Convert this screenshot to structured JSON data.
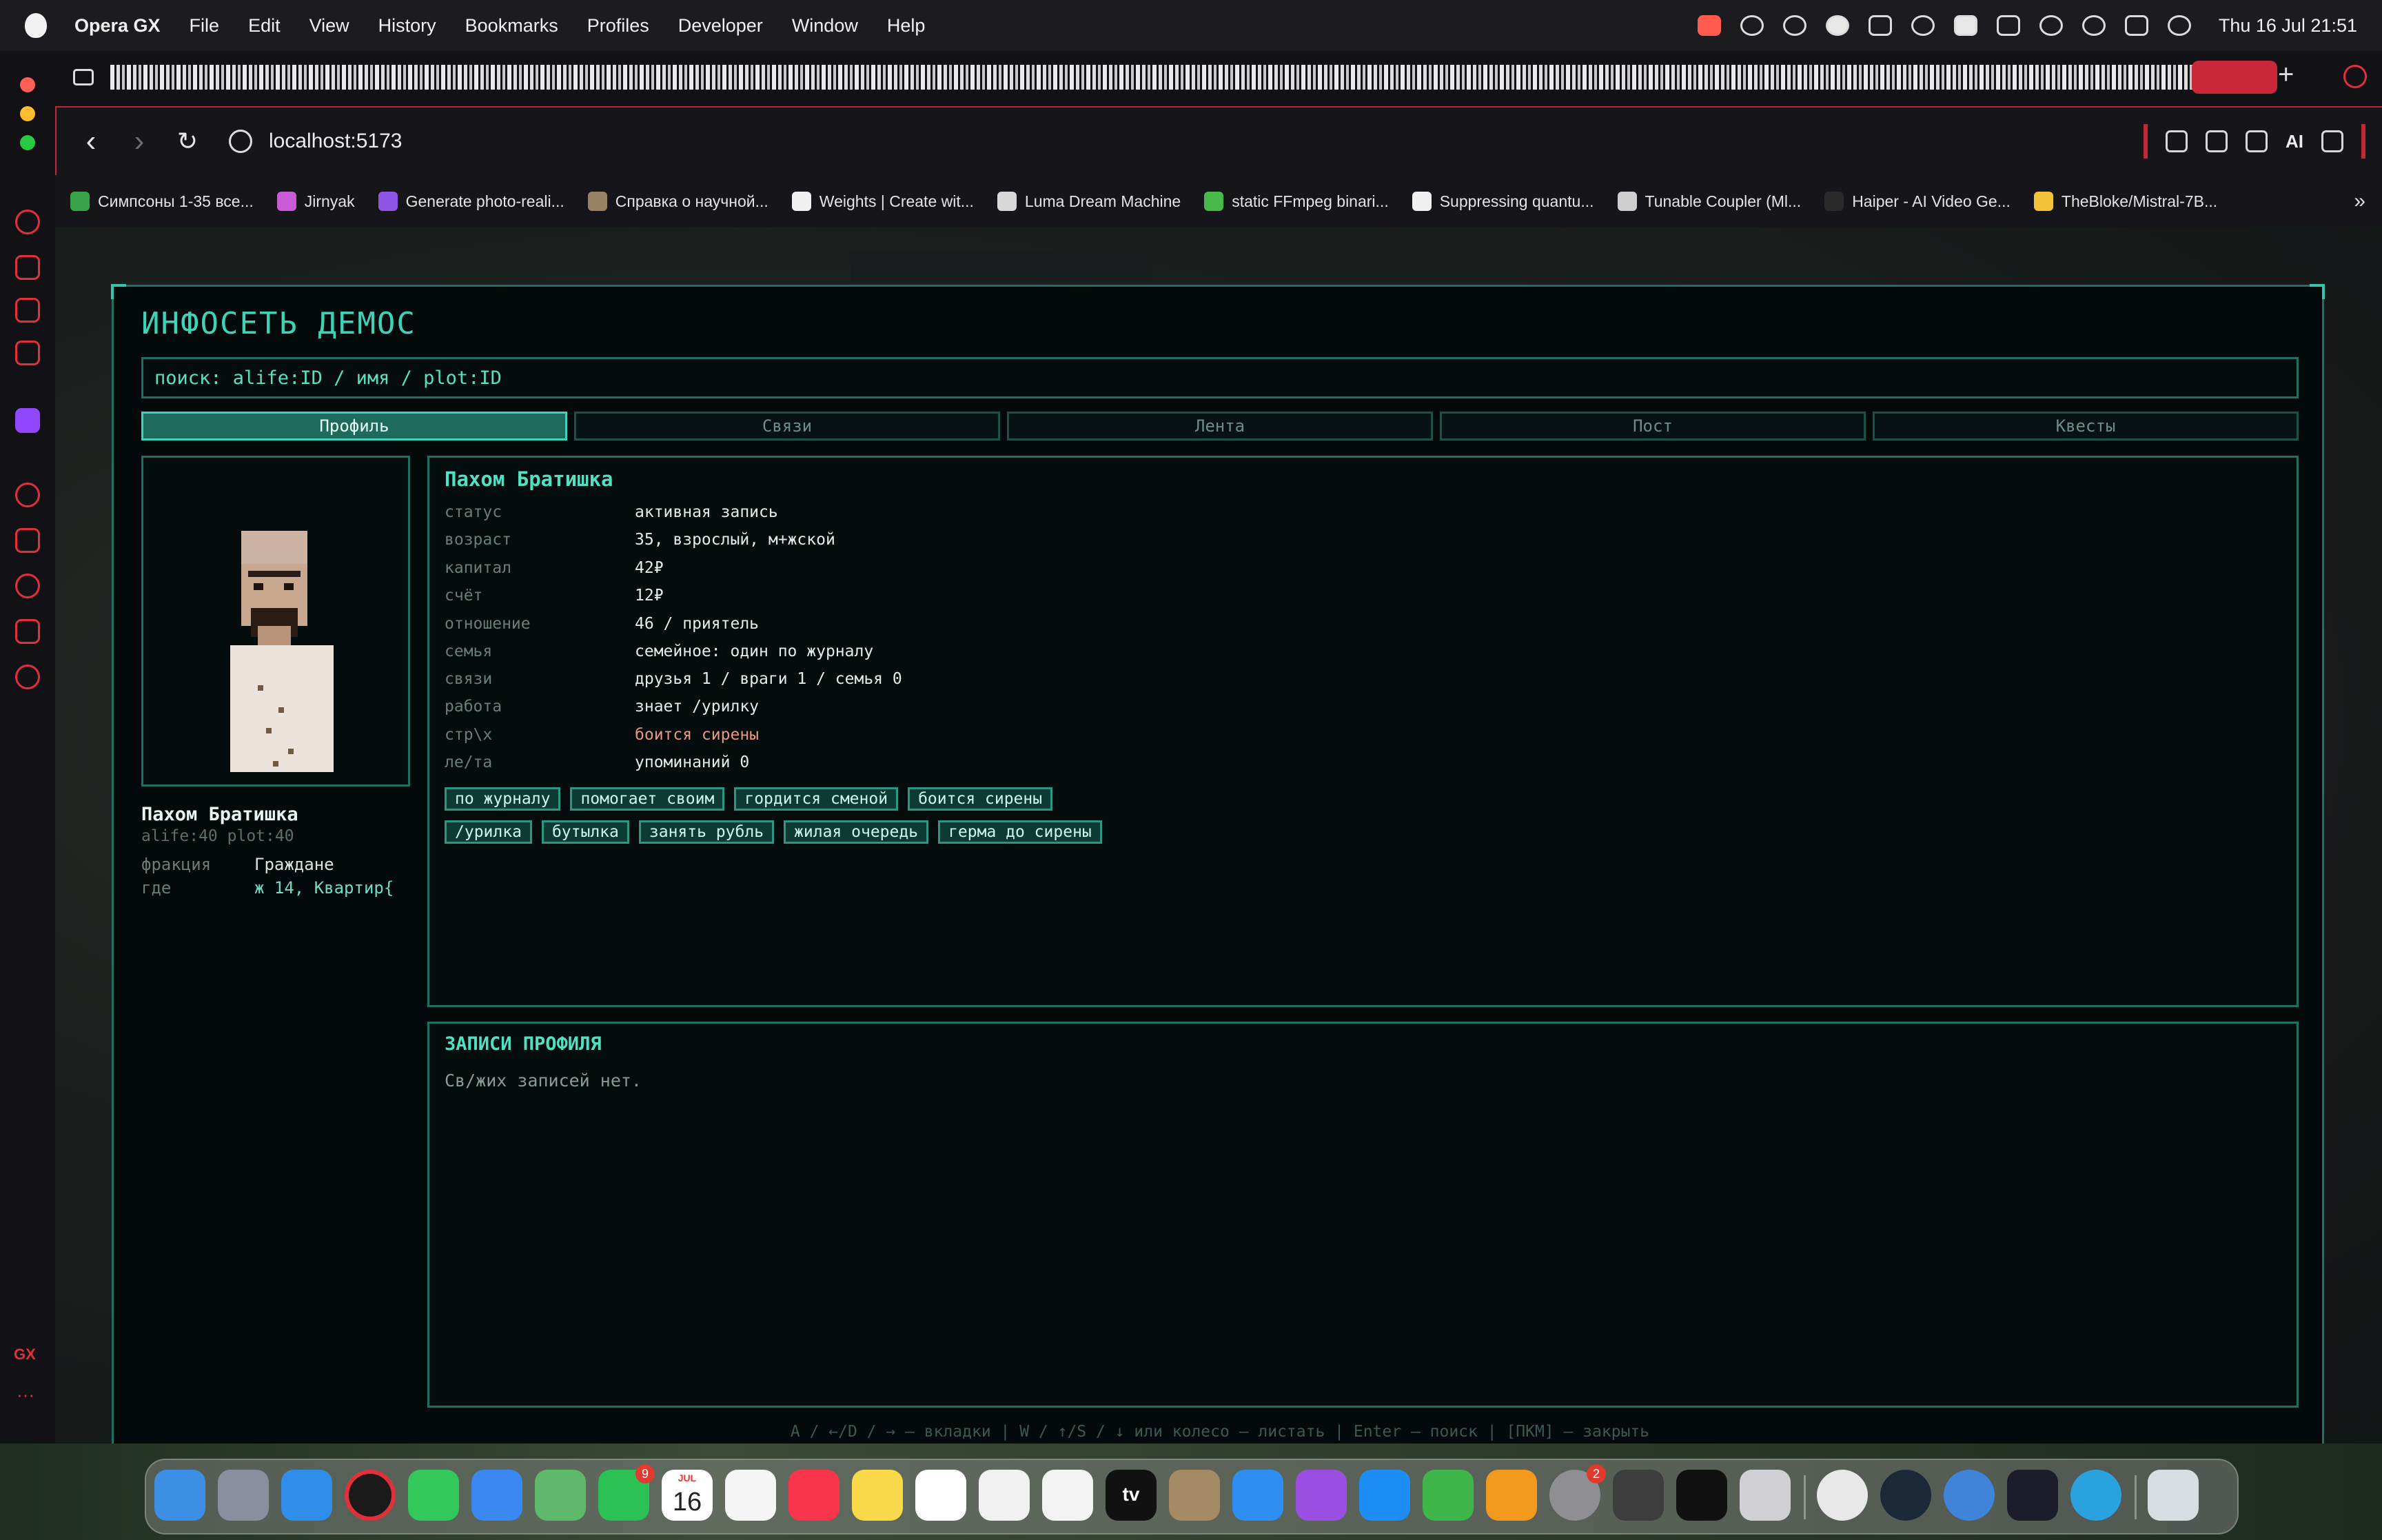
{
  "menubar": {
    "app_name": "Opera GX",
    "items": [
      "File",
      "Edit",
      "View",
      "History",
      "Bookmarks",
      "Profiles",
      "Developer",
      "Window",
      "Help"
    ],
    "clock": "Thu 16 Jul  21:51"
  },
  "browser": {
    "url": "localhost:5173",
    "ai_label": "AI",
    "sidebar_logo": "GX",
    "bookmarks": [
      {
        "label": "Симпсоны 1-35 все...",
        "color": "#3aa34a"
      },
      {
        "label": "Jirnyak",
        "color": "#c95ad6"
      },
      {
        "label": "Generate photo-reali...",
        "color": "#8f56e6"
      },
      {
        "label": "Справка о научной...",
        "color": "#9a8266"
      },
      {
        "label": "Weights | Create wit...",
        "color": "#f0f0f0"
      },
      {
        "label": "Luma Dream Machine",
        "color": "#d8d8d8"
      },
      {
        "label": "static FFmpeg binari...",
        "color": "#49b84a"
      },
      {
        "label": "Suppressing quantu...",
        "color": "#f0f0f0"
      },
      {
        "label": "Tunable Coupler (Ml...",
        "color": "#cfcfcf"
      },
      {
        "label": "Haiper - AI Video Ge...",
        "color": "#2b2b2b"
      },
      {
        "label": "TheBloke/Mistral-7B...",
        "color": "#f3c23a"
      }
    ]
  },
  "app": {
    "title": "ИНФОСЕТЬ ДЕМОС",
    "search_placeholder": "поиск: alife:ID / имя / plot:ID",
    "tabs": [
      "Профиль",
      "Связи",
      "Лента",
      "Пост",
      "Квесты"
    ],
    "active_tab": 0,
    "side": {
      "name": "Пахом Братишка",
      "ids": "alife:40 plot:40",
      "fields": [
        {
          "key": "фракция",
          "value": "Граждане"
        },
        {
          "key": "где",
          "value": "ж 14, Квартир{"
        }
      ]
    },
    "profile": {
      "name": "Пахом Братишка",
      "fields": [
        {
          "key": "статус",
          "value": "активная запись"
        },
        {
          "key": "возраст",
          "value": "35, взрослый, м+жской"
        },
        {
          "key": "капитал",
          "value": "42₽"
        },
        {
          "key": "счёт",
          "value": "12₽"
        },
        {
          "key": "отношение",
          "value": "46 / приятель"
        },
        {
          "key": "семья",
          "value": "семейное: один по журналу"
        },
        {
          "key": "связи",
          "value": "друзья 1 / враги 1 / семья 0"
        },
        {
          "key": "работа",
          "value": "знает /урилку"
        },
        {
          "key": "стр\\х",
          "value": "боится сирены"
        },
        {
          "key": "ле/та",
          "value": "упоминаний 0"
        }
      ],
      "tags_row1": [
        "по журналу",
        "помогает своим",
        "гордится сменой",
        "боится сирены"
      ],
      "tags_row2": [
        "/урилка",
        "бутылка",
        "занять рубль",
        "жилая очередь",
        "герма до сирены"
      ]
    },
    "records": {
      "title": "ЗАПИСИ ПРОФИЛЯ",
      "empty": "Св/жих записей нет."
    },
    "hint": "A / ←/D / → — вкладки  |  W / ↑/S / ↓ или колесо — листать  |  Enter — поиск  |  [ПКМ] — закрыть"
  },
  "dock": {
    "calendar": {
      "month": "JUL",
      "day": "16"
    },
    "tv_label": "tv",
    "badges": {
      "facetime": "9",
      "settings": "2"
    }
  }
}
